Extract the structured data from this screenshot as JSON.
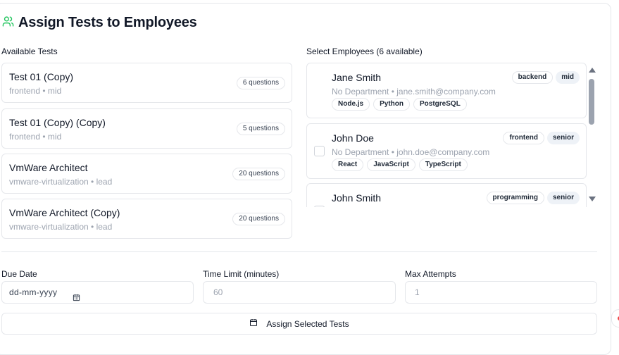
{
  "header": {
    "title": "Assign Tests to Employees",
    "icon": "users-icon",
    "icon_color": "#22c55e"
  },
  "tests": {
    "label": "Available Tests",
    "items": [
      {
        "name": "Test 01 (Copy)",
        "meta": "frontend • mid",
        "questions": "6 questions"
      },
      {
        "name": "Test 01 (Copy) (Copy)",
        "meta": "frontend • mid",
        "questions": "5 questions"
      },
      {
        "name": "VmWare Architect",
        "meta": "vmware-virtualization • lead",
        "questions": "20 questions"
      },
      {
        "name": "VmWare Architect (Copy)",
        "meta": "vmware-virtualization • lead",
        "questions": "20 questions"
      }
    ]
  },
  "employees": {
    "label": "Select Employees (6 available)",
    "items": [
      {
        "name": "Jane Smith",
        "meta": "No Department • jane.smith@company.com",
        "role": "backend",
        "level": "mid",
        "skills": [
          "Node.js",
          "Python",
          "PostgreSQL"
        ]
      },
      {
        "name": "John Doe",
        "meta": "No Department • john.doe@company.com",
        "role": "frontend",
        "level": "senior",
        "skills": [
          "React",
          "JavaScript",
          "TypeScript"
        ]
      },
      {
        "name": "John Smith",
        "meta": "",
        "role": "programming",
        "level": "senior",
        "skills": []
      }
    ]
  },
  "form": {
    "due_date": {
      "label": "Due Date",
      "placeholder": "dd-mm-yyyy"
    },
    "time_limit": {
      "label": "Time Limit (minutes)",
      "placeholder": "60"
    },
    "max_attempts": {
      "label": "Max Attempts",
      "placeholder": "1"
    },
    "assign_label": "Assign Selected Tests"
  }
}
